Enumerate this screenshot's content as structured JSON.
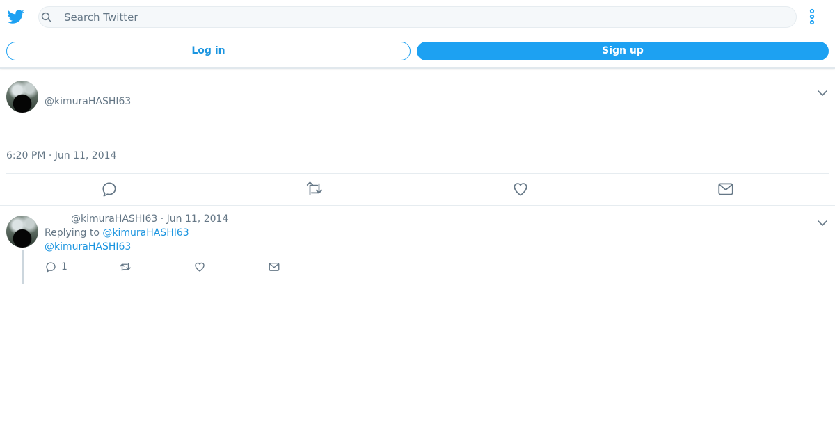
{
  "header": {
    "search": {
      "placeholder": "Search Twitter",
      "value": ""
    },
    "icons": {
      "logo": "twitter-bird-icon",
      "search": "search-icon",
      "more": "more-vertical-icon"
    }
  },
  "auth": {
    "login_label": "Log in",
    "signup_label": "Sign up"
  },
  "main_tweet": {
    "handle": "@kimuraHASHI63",
    "timestamp": "6:20 PM · Jun 11, 2014"
  },
  "reply_tweet": {
    "handle": "@kimuraHASHI63",
    "date": "· Jun 11, 2014",
    "replying_to_label": "Replying to",
    "replying_to_mention": "@kimuraHASHI63",
    "body_mention": "@kimuraHASHI63",
    "reply_count": "1"
  },
  "colors": {
    "brand_blue": "#1da1f2",
    "link_blue": "#1b95e0",
    "secondary_text": "#657786",
    "divider": "#e6ecf0"
  }
}
